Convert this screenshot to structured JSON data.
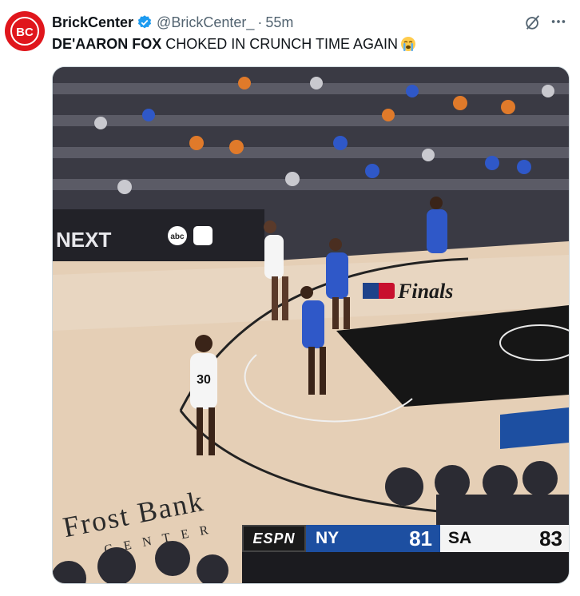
{
  "account": {
    "display_name": "BrickCenter",
    "handle": "@BrickCenter_",
    "separator": "·",
    "time": "55m",
    "avatar_icon": "brickcenter-logo"
  },
  "tweet": {
    "text_bold": "DE'AARON FOX",
    "text_rest": " CHOKED IN CRUNCH TIME AGAIN",
    "emoji_icon": "loudly-crying-face"
  },
  "media": {
    "scene": "NBA Finals game clip, court view",
    "arena_text_line1": "Frost Bank",
    "arena_text_line2": "CENTER",
    "finals_logo": "Finals",
    "board_next": "NEXT",
    "board_network": "abc",
    "scorebug": {
      "network": "ESPN",
      "away_team": "NY",
      "away_score": "81",
      "home_team": "SA",
      "home_score": "83"
    }
  },
  "colors": {
    "verified": "#1d9bf0",
    "avatar_bg": "#e0161c",
    "away_team_bg": "#1d4fa1"
  }
}
